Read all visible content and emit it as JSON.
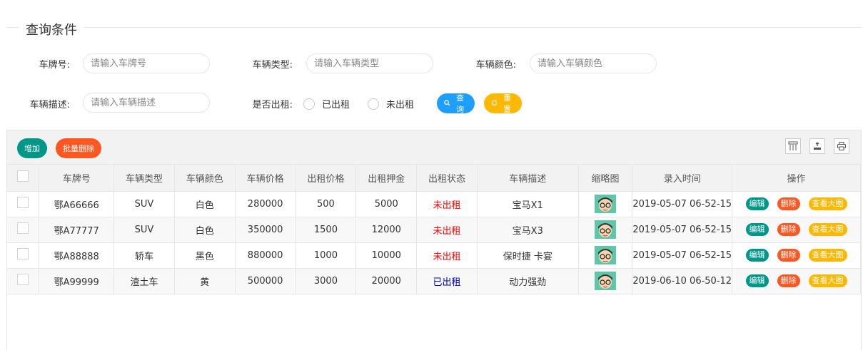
{
  "query": {
    "title": "查询条件",
    "fields": {
      "plate": {
        "label": "车牌号:",
        "placeholder": "请输入车牌号"
      },
      "type": {
        "label": "车辆类型:",
        "placeholder": "请输入车辆类型"
      },
      "color": {
        "label": "车辆颜色:",
        "placeholder": "请输入车辆颜色"
      },
      "desc": {
        "label": "车辆描述:",
        "placeholder": "请输入车辆描述"
      }
    },
    "rented": {
      "label": "是否出租:",
      "option_yes": "已出租",
      "option_no": "未出租"
    },
    "search_label": "查询",
    "reset_label": "重置"
  },
  "toolbar": {
    "add_label": "增加",
    "batch_delete_label": "批量删除"
  },
  "table": {
    "headers": [
      "车牌号",
      "车辆类型",
      "车辆颜色",
      "车辆价格",
      "出租价格",
      "出租押金",
      "出租状态",
      "车辆描述",
      "缩略图",
      "录入时间",
      "操作"
    ],
    "rows": [
      [
        "鄂A66666",
        "SUV",
        "白色",
        "280000",
        "500",
        "5000",
        "未出租",
        "宝马X1",
        "2019-05-07 06-52-15"
      ],
      [
        "鄂A77777",
        "SUV",
        "白色",
        "350000",
        "1500",
        "12000",
        "未出租",
        "宝马X3",
        "2019-05-07 06-52-15"
      ],
      [
        "鄂A88888",
        "轿车",
        "黑色",
        "880000",
        "1000",
        "10000",
        "未出租",
        "保时捷 卡宴",
        "2019-05-07 06-52-15"
      ],
      [
        "鄂A99999",
        "渣土车",
        "黄",
        "500000",
        "3000",
        "20000",
        "已出租",
        "动力强劲",
        "2019-06-10 06-50-12"
      ]
    ],
    "actions": {
      "edit": "编辑",
      "delete": "删除",
      "view": "查看大图"
    }
  },
  "colors": {
    "blue": "#1e9fff",
    "yellow": "#ffb800",
    "teal": "#009688",
    "orange": "#ff5722",
    "status_not_rented": "#ff0000",
    "status_rented": "#0000cc"
  }
}
